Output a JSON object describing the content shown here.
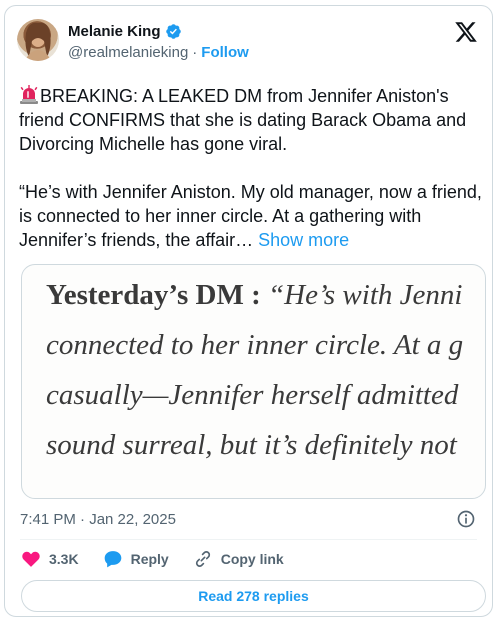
{
  "author": {
    "name": "Melanie King",
    "handle": "@realmelanieking",
    "separator": "·",
    "follow_label": "Follow"
  },
  "tweet": {
    "line1": "BREAKING: A LEAKED DM from Jennifer Aniston's friend CONFIRMS that she is dating Barack Obama and Divorcing Michelle has gone viral.",
    "line2": "“He’s with Jennifer Aniston. My old manager, now a friend, is connected to her inner circle. At a gathering with Jennifer’s friends, the affair…",
    "show_more": "Show more"
  },
  "media": {
    "label": "Yesterday’s DM :",
    "line1_quote": " “He’s with Jenni",
    "line2": "connected to her inner circle. At a g",
    "line3": "casually—Jennifer herself admitted",
    "line4": "sound surreal, but it’s definitely not"
  },
  "timestamp": "7:41 PM · Jan 22, 2025",
  "actions": {
    "likes": "3.3K",
    "reply": "Reply",
    "copy_link": "Copy link"
  },
  "read_replies": "Read 278 replies",
  "colors": {
    "accent": "#1d9bf0",
    "like": "#f91880",
    "muted": "#536471",
    "siren": "#e0245e"
  },
  "icons": [
    "verified-badge-icon",
    "x-logo-icon",
    "siren-emoji-icon",
    "info-icon",
    "heart-icon",
    "reply-bubble-icon",
    "link-icon"
  ]
}
